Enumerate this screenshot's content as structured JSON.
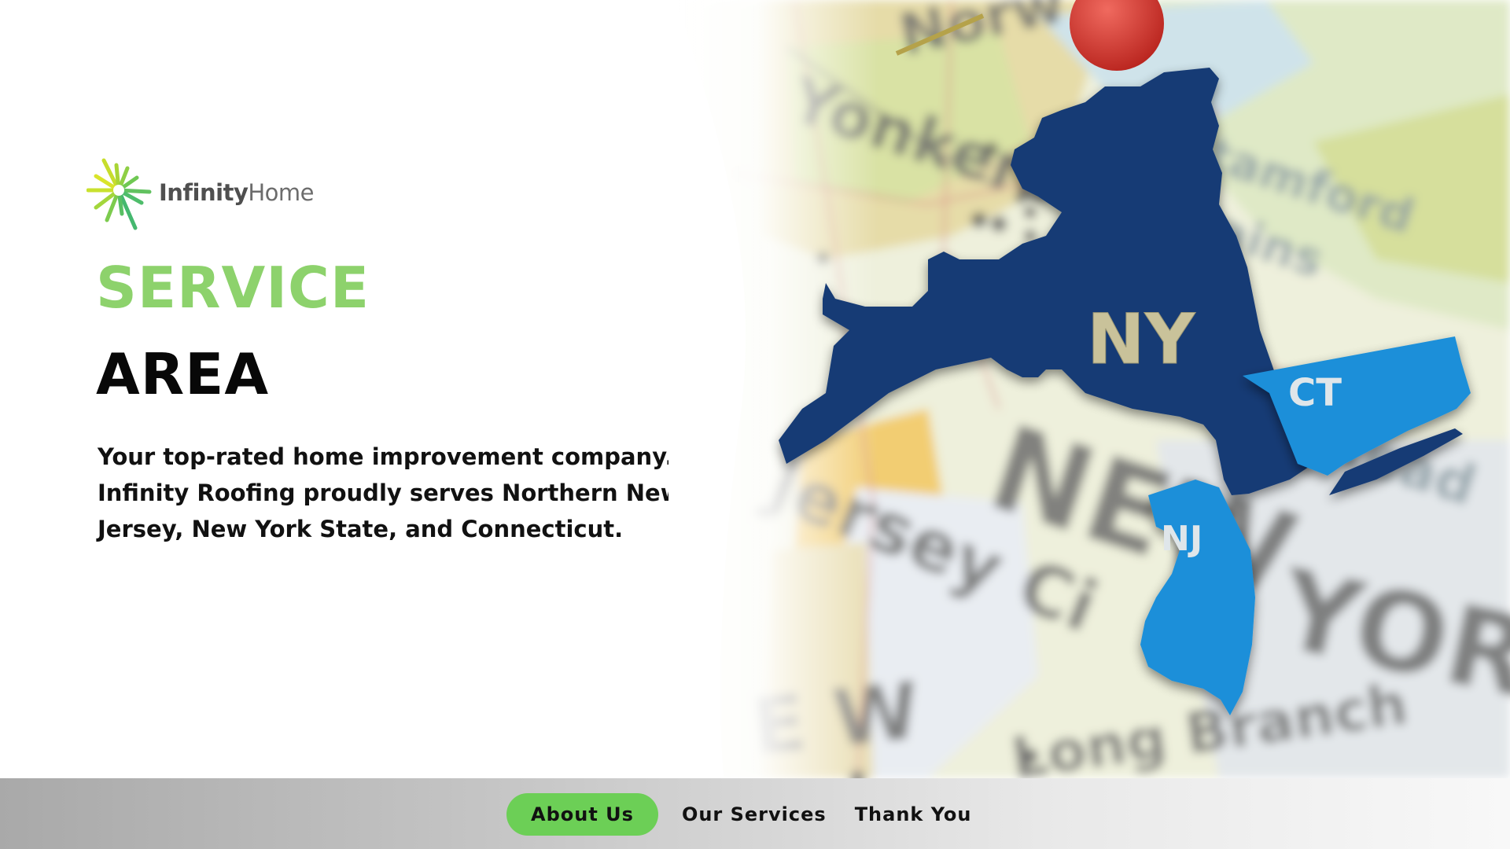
{
  "brand": {
    "name_bold": "Infinity",
    "name_light": "Home",
    "accent_color": "#8dd26c",
    "logo_icon": "starburst-icon"
  },
  "hero": {
    "title_line1": "SERVICE",
    "title_line2": "AREA",
    "description": "Your top-rated home improvement company. Infinity Roofing proudly serves Northern New Jersey, New York State, and Connecticut."
  },
  "map": {
    "states": [
      {
        "abbr": "NY",
        "color": "#173b74"
      },
      {
        "abbr": "CT",
        "color": "#1e8fd9"
      },
      {
        "abbr": "NJ",
        "color": "#1e8fd9"
      }
    ],
    "background_places": [
      "Yonkers",
      "Stamford",
      "Plains",
      "NEW",
      "Jersey Ci",
      "Long Branch",
      "YORK",
      "pstead",
      "Norw"
    ],
    "pin_color": "#d7322b"
  },
  "footer": {
    "nav": [
      {
        "label": "About Us",
        "active": true
      },
      {
        "label": "Our Services",
        "active": false
      },
      {
        "label": "Thank You",
        "active": false
      }
    ],
    "active_color": "#6ccf56"
  }
}
